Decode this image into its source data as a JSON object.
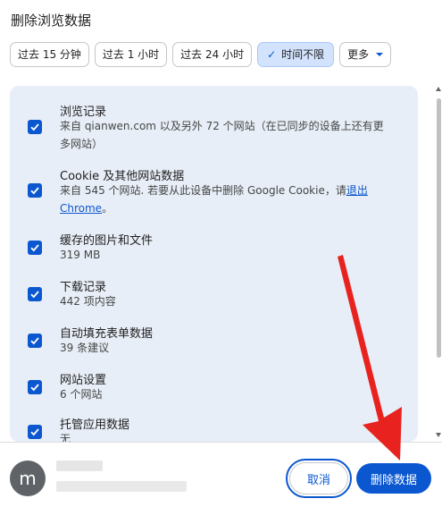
{
  "dialog": {
    "title": "删除浏览数据"
  },
  "time_chips": [
    {
      "label": "过去 15 分钟",
      "selected": false
    },
    {
      "label": "过去 1 小时",
      "selected": false
    },
    {
      "label": "过去 24 小时",
      "selected": false
    },
    {
      "label": "时间不限",
      "selected": true
    },
    {
      "label": "更多",
      "selected": false
    }
  ],
  "items": [
    {
      "title": "浏览记录",
      "desc": "来自 qianwen.com 以及另外 72 个网站（在已同步的设备上还有更多网站）",
      "checked": true
    },
    {
      "title": "Cookie 及其他网站数据",
      "desc_prefix": "来自 545 个网站. 若要从此设备中删除 Google Cookie，请",
      "desc_link": "退出 Chrome",
      "desc_suffix": "。",
      "checked": true
    },
    {
      "title": "缓存的图片和文件",
      "desc": "319 MB",
      "checked": true
    },
    {
      "title": "下载记录",
      "desc": "442 项内容",
      "checked": true
    },
    {
      "title": "自动填充表单数据",
      "desc": "39 条建议",
      "checked": true
    },
    {
      "title": "网站设置",
      "desc": "6 个网站",
      "checked": true
    },
    {
      "title": "托管应用数据",
      "desc": "无",
      "checked": true
    }
  ],
  "footer": {
    "avatar_letter": "m",
    "cancel_label": "取消",
    "delete_label": "删除数据"
  },
  "colors": {
    "accent": "#0b57d0",
    "panel_bg": "#e8eef7",
    "chip_selected_bg": "#d3e3fd",
    "annotation_arrow": "#e8231f"
  }
}
